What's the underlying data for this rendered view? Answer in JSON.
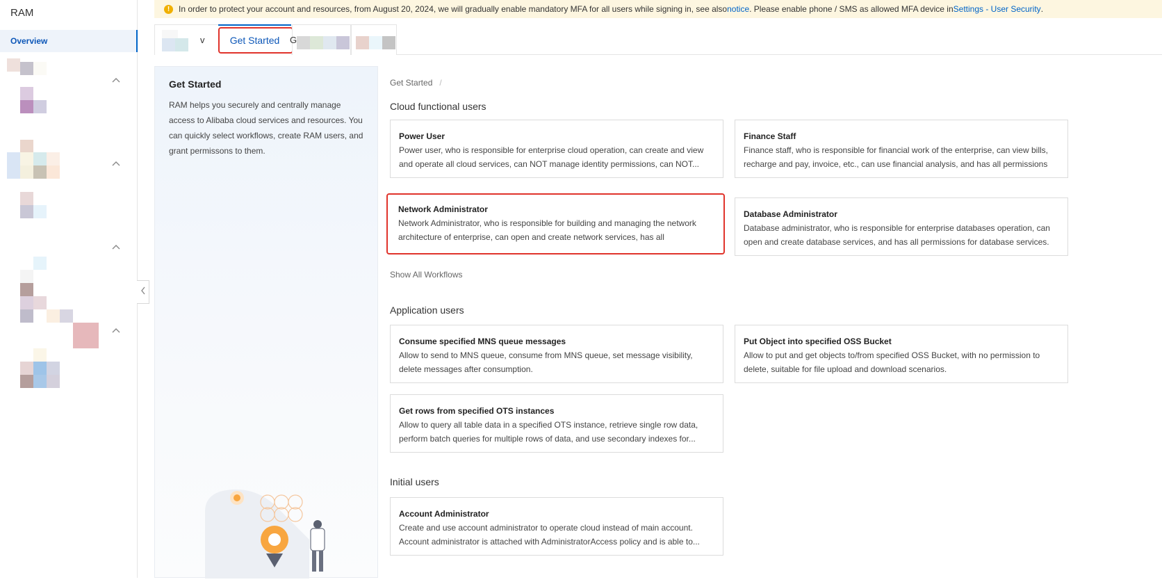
{
  "sidebar": {
    "title": "RAM",
    "overview": "Overview"
  },
  "banner": {
    "text_before": "In order to protect your account and resources, from August 20, 2024, we will gradually enable mandatory MFA for all users while signing in, see also ",
    "link_notice": "notice",
    "text_middle": ". Please enable phone / SMS as allowed MFA device in ",
    "link_settings": "Settings - User Security",
    "text_after": "."
  },
  "tabs": {
    "tab1_suffix": "v",
    "active": "Get Started",
    "tab3_prefix": "G"
  },
  "info": {
    "title": "Get Started",
    "description": "RAM helps you securely and centrally manage access to Alibaba cloud services and resources. You can quickly select workflows, create RAM users, and grant permissons to them."
  },
  "main": {
    "breadcrumb": "Get Started",
    "breadcrumb_sep": "/",
    "show_all": "Show All Workflows",
    "sections": [
      {
        "title": "Cloud functional users",
        "cards": [
          {
            "title": "Power User",
            "desc": "Power user, who is responsible for enterprise cloud operation, can create and view and operate all cloud services, can NOT manage identity permissions, can NOT..."
          },
          {
            "title": "Finance Staff",
            "desc": "Finance staff, who is responsible for financial work of the enterprise, can view bills, recharge and pay, invoice, etc., can use financial analysis, and has all permissions for..."
          },
          {
            "title": "Network Administrator",
            "desc": "Network Administrator, who is responsible for building and managing the network architecture of enterprise, can open and create network services, has all permissions..."
          },
          {
            "title": "Database Administrator",
            "desc": "Database administrator, who is responsible for enterprise databases operation, can open and create database services, and has all permissions for database services."
          }
        ]
      },
      {
        "title": "Application users",
        "cards": [
          {
            "title": "Consume specified MNS queue messages",
            "desc": "Allow to send to MNS queue, consume from MNS queue, set message visibility, delete messages after consumption."
          },
          {
            "title": "Put Object into specified OSS Bucket",
            "desc": "Allow to put and get objects to/from specified OSS Bucket, with no permission to delete, suitable for file upload and download scenarios."
          },
          {
            "title": "Get rows from specified OTS instances",
            "desc": "Allow to query all table data in a specified OTS instance, retrieve single row data, perform batch queries for multiple rows of data, and use secondary indexes for..."
          }
        ]
      },
      {
        "title": "Initial users",
        "cards": [
          {
            "title": "Account Administrator",
            "desc": "Create and use account administrator to operate cloud instead of main account. Account administrator is attached with AdministratorAccess policy and is able to..."
          }
        ]
      }
    ]
  },
  "colors": {
    "accent": "#0064c8",
    "highlight": "#e0332b",
    "banner_bg": "#fdf6e0",
    "warning": "#f0b000"
  },
  "icons": [
    "warning-icon",
    "chevron-up-icon",
    "chevron-left-icon"
  ]
}
